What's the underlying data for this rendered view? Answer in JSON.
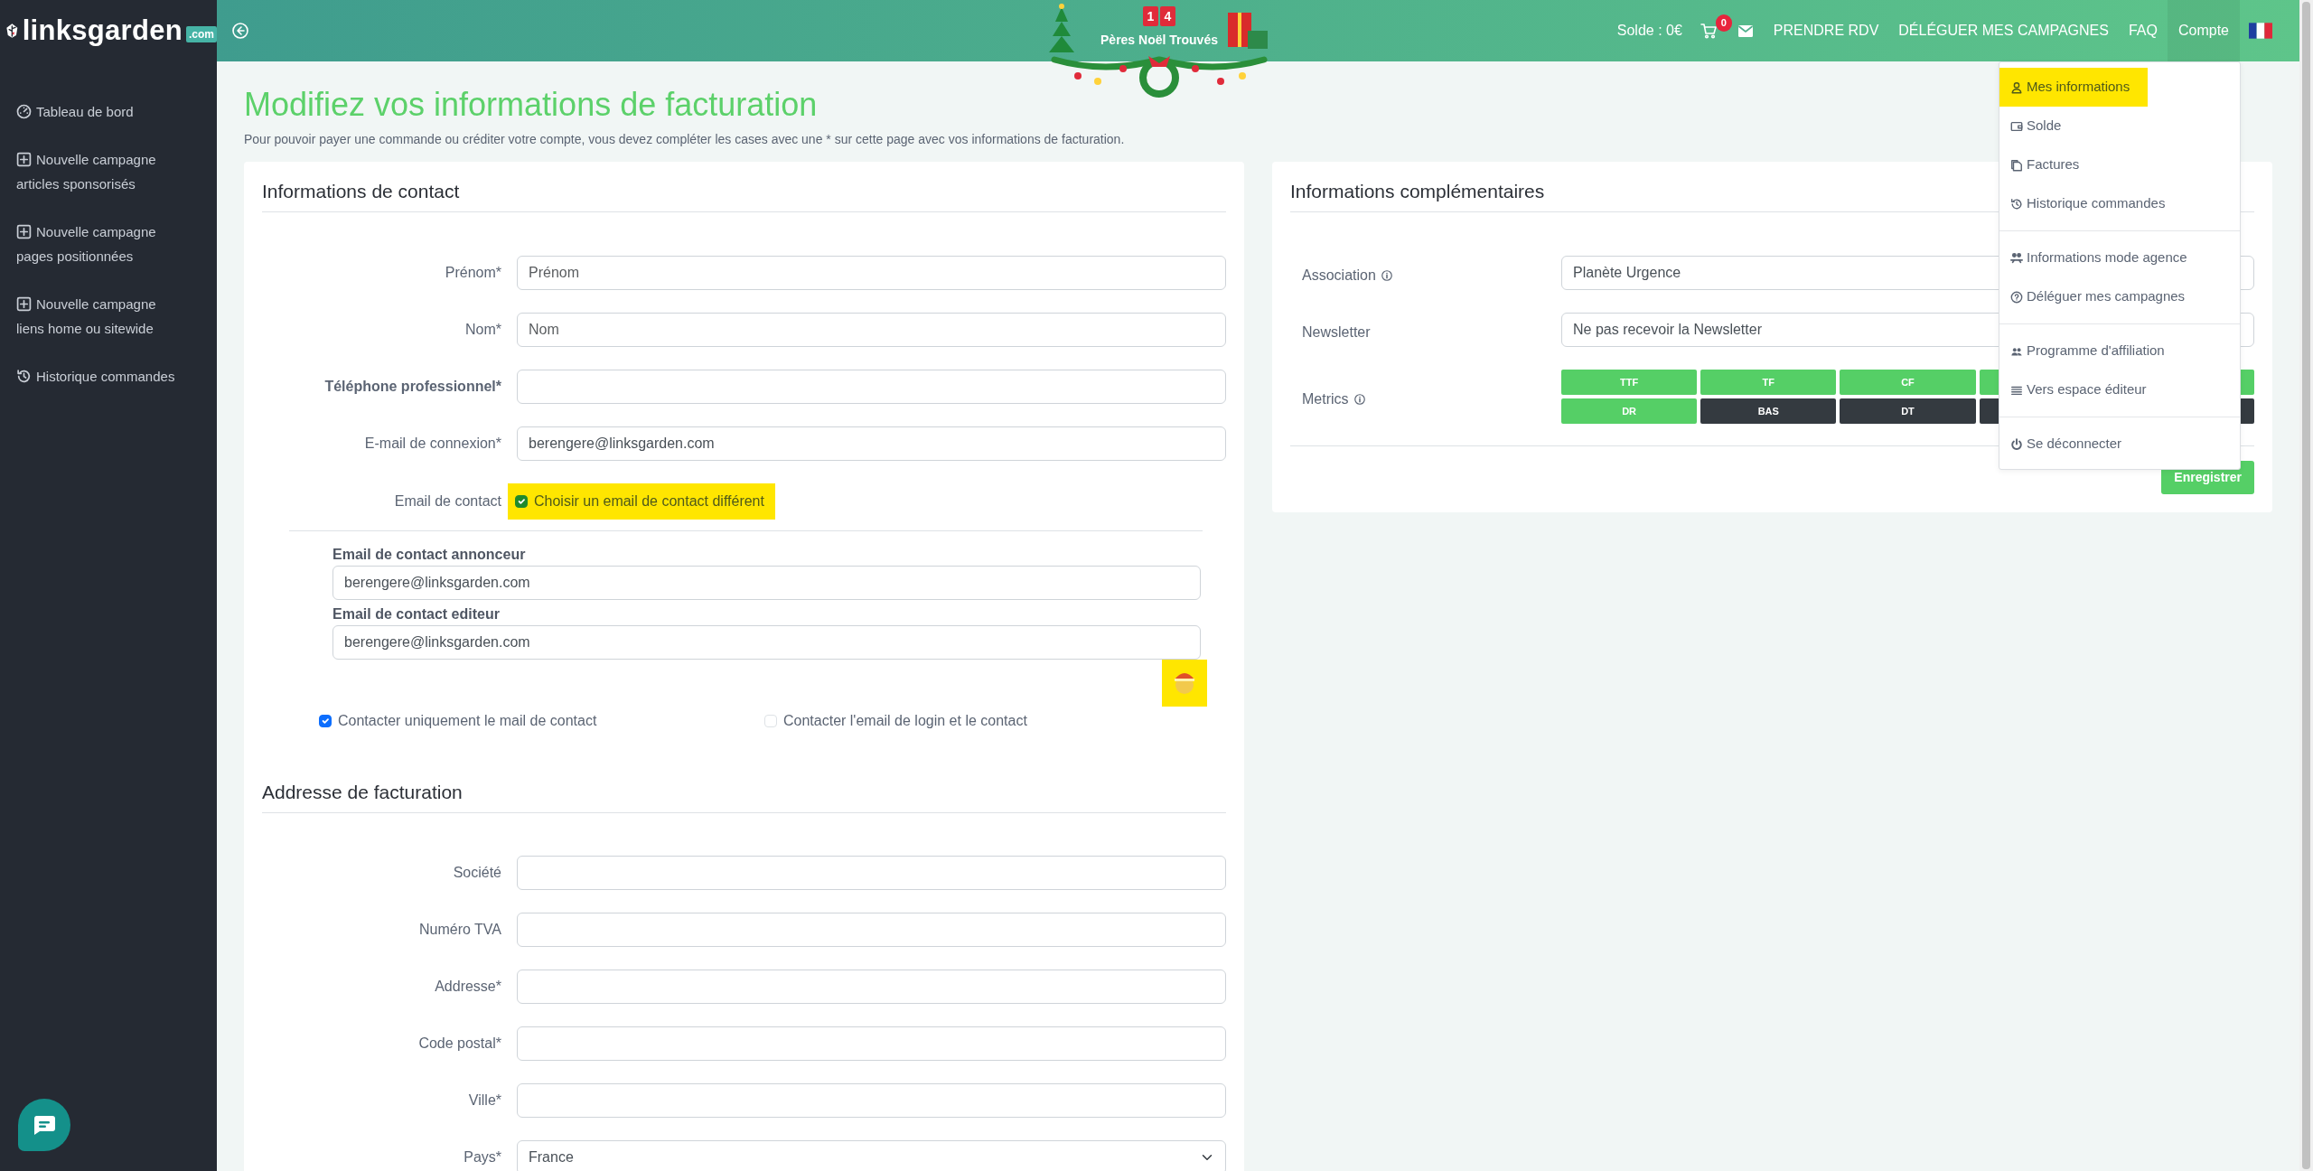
{
  "sidebar": {
    "logo": "linksgarden",
    "logo_suffix": ".com",
    "items": [
      {
        "lines": [
          "Tableau de bord"
        ]
      },
      {
        "lines": [
          "Nouvelle campagne",
          "articles sponsorisés"
        ]
      },
      {
        "lines": [
          "Nouvelle campagne",
          "pages positionnées"
        ]
      },
      {
        "lines": [
          "Nouvelle campagne",
          "liens home ou sitewide"
        ]
      },
      {
        "lines": [
          "Historique commandes"
        ]
      }
    ]
  },
  "banner": {
    "counter": [
      "1",
      "4"
    ],
    "title": "Pères Noël Trouvés"
  },
  "navbar": {
    "balance": "Solde : 0€",
    "cart_count": "0",
    "links": [
      {
        "label": "PRENDRE RDV",
        "selected": false
      },
      {
        "label": "DÉLÉGUER MES CAMPAGNES",
        "selected": false
      },
      {
        "label": "FAQ",
        "selected": false
      },
      {
        "label": "Compte",
        "selected": true
      }
    ]
  },
  "account_menu": {
    "groups": [
      [
        {
          "label": "Mes informations",
          "highlighted": true
        },
        {
          "label": "Solde",
          "highlighted": false
        },
        {
          "label": "Factures",
          "highlighted": false
        },
        {
          "label": "Historique commandes",
          "highlighted": false
        }
      ],
      [
        {
          "label": "Informations mode agence",
          "highlighted": false
        },
        {
          "label": "Déléguer mes campagnes",
          "highlighted": false
        }
      ],
      [
        {
          "label": "Programme d'affiliation",
          "highlighted": false
        },
        {
          "label": "Vers espace éditeur",
          "highlighted": false
        }
      ],
      [
        {
          "label": "Se déconnecter",
          "highlighted": false
        }
      ]
    ]
  },
  "page": {
    "title": "Modifiez vos informations de facturation",
    "subtitle": "Pour pouvoir payer une commande ou créditer votre compte, vous devez compléter les cases avec une * sur cette page avec vos informations de facturation."
  },
  "contact_card": {
    "title": "Informations de contact",
    "fields": [
      {
        "label": "Prénom*",
        "bold": false,
        "placeholder": "Prénom"
      },
      {
        "label": "Nom*",
        "bold": false,
        "placeholder": "Nom"
      },
      {
        "label": "Téléphone professionnel*",
        "bold": true
      },
      {
        "label": "E-mail de connexion*",
        "bold": false,
        "value": "berengere@linksgarden.com"
      }
    ],
    "contact_email": {
      "label": "Email de contact",
      "option": "Choisir un email de contact différent",
      "checked": true,
      "highlighted": true
    },
    "contact_emails": [
      {
        "label": "Email de contact annonceur",
        "value": "berengere@linksgarden.com"
      },
      {
        "label": "Email de contact editeur",
        "value": "berengere@linksgarden.com"
      }
    ],
    "contact_options": [
      {
        "label": "Contacter uniquement le mail de contact",
        "checked": true
      },
      {
        "label": "Contacter l'email de login et le contact",
        "checked": false
      }
    ]
  },
  "billing_card": {
    "title": "Addresse de facturation",
    "fields": [
      {
        "label": "Société",
        "kind": "text"
      },
      {
        "label": "Numéro TVA",
        "kind": "text"
      },
      {
        "label": "Addresse*",
        "kind": "text"
      },
      {
        "label": "Code postal*",
        "kind": "text"
      },
      {
        "label": "Ville*",
        "kind": "text"
      },
      {
        "label": "Pays*",
        "kind": "select",
        "value": "France"
      }
    ]
  },
  "extra_card": {
    "title": "Informations complémentaires",
    "fields": [
      {
        "label": "Association",
        "info": true,
        "value": "Planète Urgence"
      },
      {
        "label": "Newsletter",
        "info": false,
        "value": "Ne pas recevoir la Newsletter"
      }
    ],
    "metrics": {
      "label": "Metrics",
      "info": true,
      "buttons": [
        {
          "label": "TTF",
          "active": true
        },
        {
          "label": "TF",
          "active": true
        },
        {
          "label": "CF",
          "active": true
        },
        {
          "active": true
        },
        {
          "active": true
        },
        {
          "label": "DR",
          "active": true
        },
        {
          "label": "BAS",
          "active": false
        },
        {
          "label": "DT",
          "active": false
        },
        {
          "active": false
        },
        {
          "active": false
        }
      ]
    },
    "save_button": "Enregistrer"
  }
}
